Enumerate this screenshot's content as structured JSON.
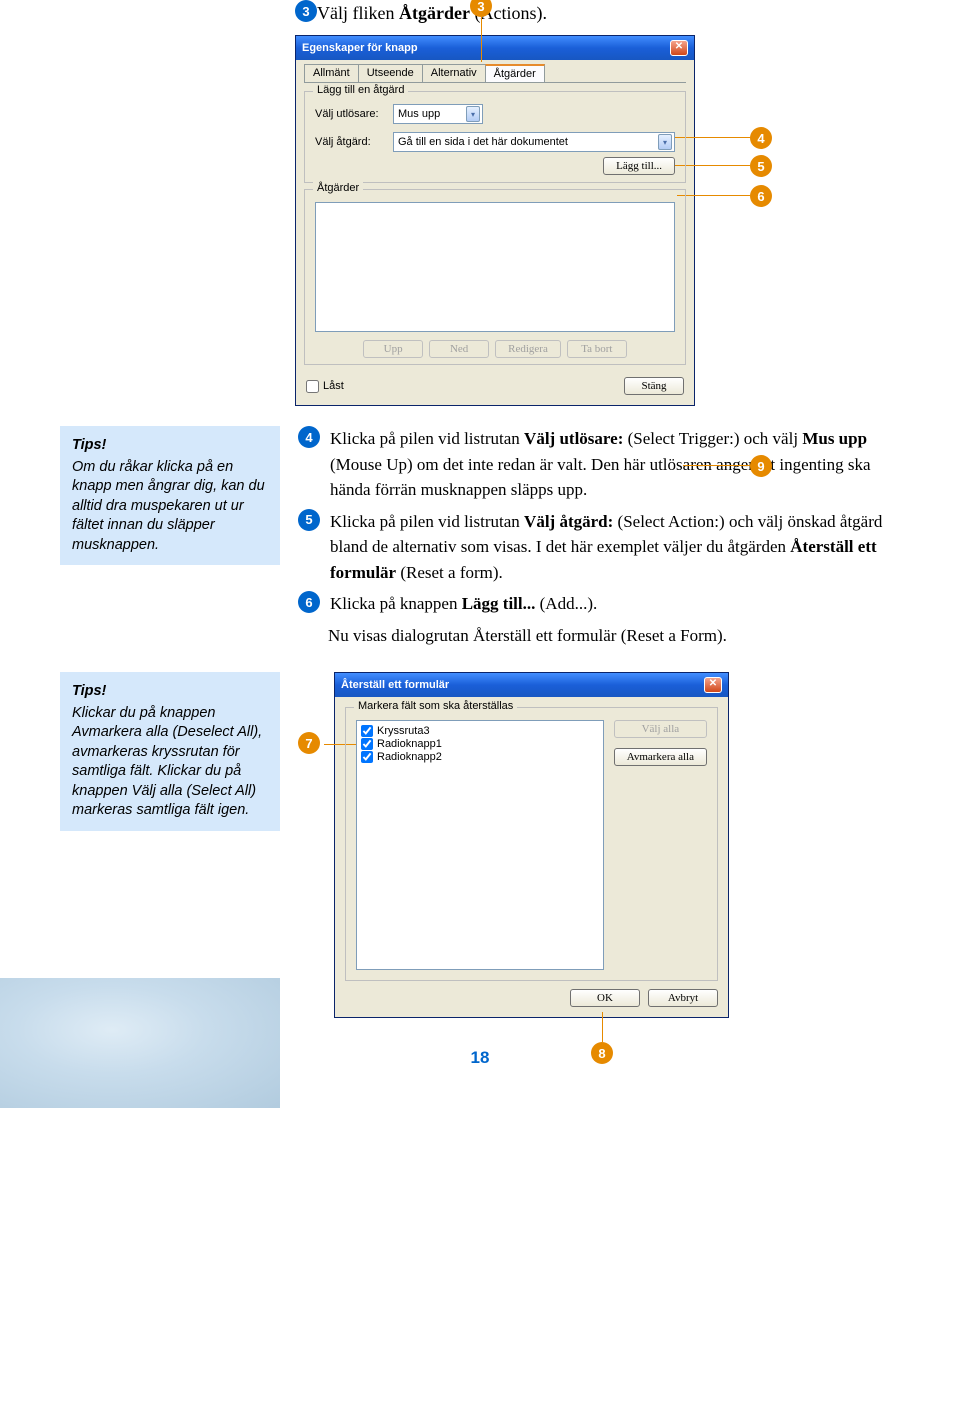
{
  "step3": {
    "num": "3",
    "text_pre": "Välj fliken ",
    "text_bold": "Åtgärder",
    "text_post": " (Actions)."
  },
  "dialog1": {
    "title": "Egenskaper för knapp",
    "tabs": [
      "Allmänt",
      "Utseende",
      "Alternativ",
      "Åtgärder"
    ],
    "group1_title": "Lägg till en åtgärd",
    "trigger_label": "Välj utlösare:",
    "trigger_value": "Mus upp",
    "action_label": "Välj åtgärd:",
    "action_value": "Gå till en sida i det här dokumentet",
    "add_btn": "Lägg till...",
    "group2_title": "Åtgärder",
    "btn_up": "Upp",
    "btn_down": "Ned",
    "btn_edit": "Redigera",
    "btn_del": "Ta bort",
    "locked": "Låst",
    "close": "Stäng"
  },
  "callouts": {
    "c3": "3",
    "c4": "4",
    "c5": "5",
    "c6": "6",
    "c7": "7",
    "c8": "8",
    "c9": "9"
  },
  "tips1": {
    "heading": "Tips!",
    "body": "Om du råkar klicka på en knapp men ångrar dig, kan du alltid dra muspekaren ut ur fältet innan du släpper musknappen."
  },
  "step4": {
    "num": "4",
    "parts": [
      "Klicka på pilen vid listrutan ",
      "Välj utlösare:",
      " (Select Trigger:) och välj ",
      "Mus upp",
      " (Mouse Up) om det inte redan är valt. Den här utlösaren anger att ingenting ska hända förrän musknappen släpps upp."
    ]
  },
  "step5": {
    "num": "5",
    "parts": [
      "Klicka på pilen vid listrutan ",
      "Välj åtgärd:",
      " (Select Action:) och välj önskad åtgärd bland de alternativ som visas. I det här exemplet väljer du åtgärden ",
      "Återställ ett formulär",
      " (Reset a form)."
    ]
  },
  "step6": {
    "num": "6",
    "parts": [
      "Klicka på knappen ",
      "Lägg till...",
      " (Add...)."
    ]
  },
  "follow": "Nu visas dialogrutan Återställ ett formulär (Reset a Form).",
  "tips2": {
    "heading": "Tips!",
    "body": "Klickar du på knappen Avmarkera alla (Deselect All), avmarkeras kryssrutan för samtliga fält. Klickar du på knappen Välj alla (Select All) markeras samtliga fält igen."
  },
  "dialog2": {
    "title": "Återställ ett formulär",
    "group_title": "Markera fält som ska återställas",
    "items": [
      "Kryssruta3",
      "Radioknapp1",
      "Radioknapp2"
    ],
    "select_all": "Välj alla",
    "deselect_all": "Avmarkera alla",
    "ok": "OK",
    "cancel": "Avbryt"
  },
  "page_num": "18"
}
